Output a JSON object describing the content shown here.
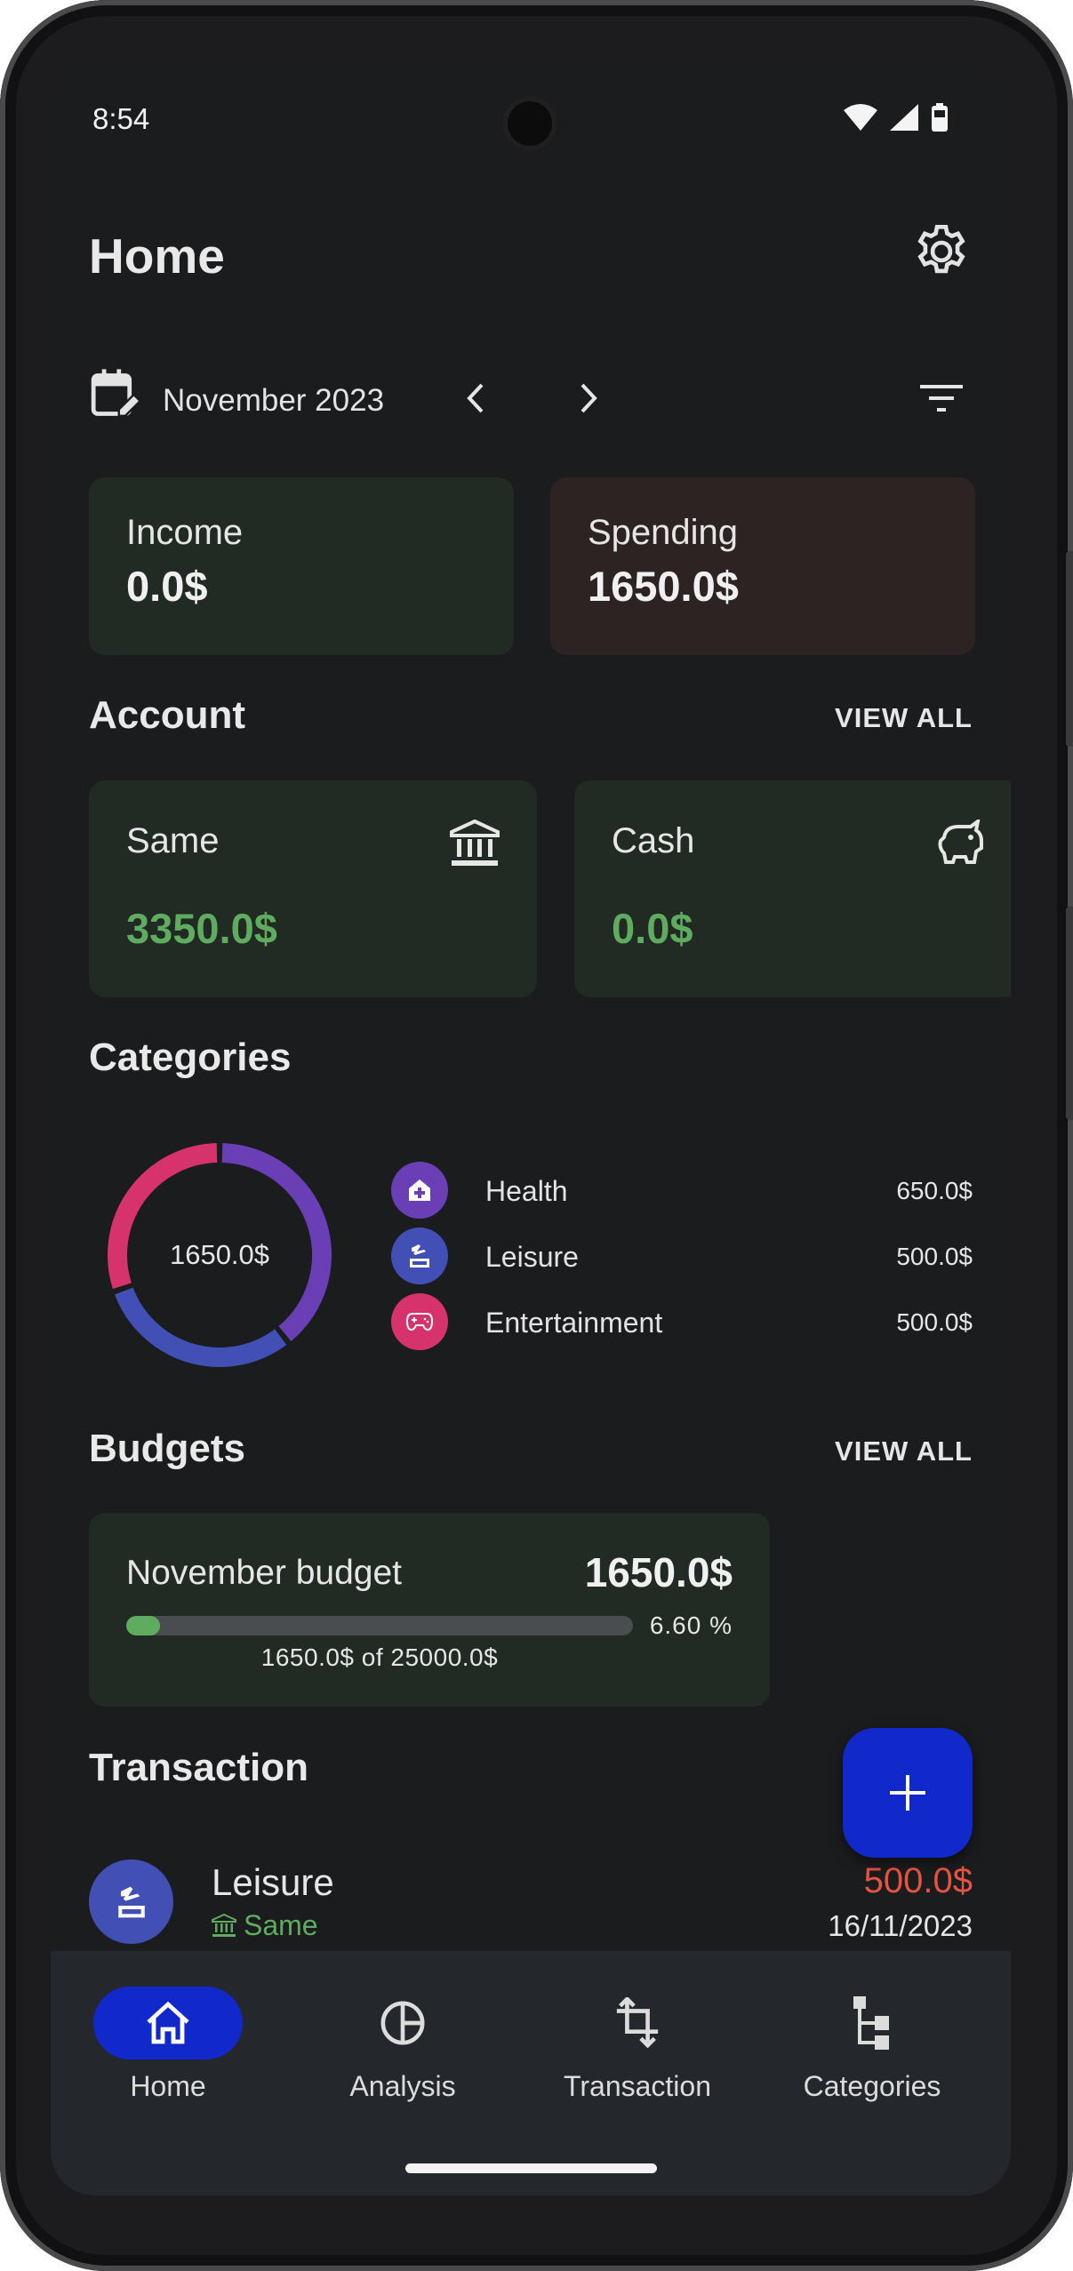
{
  "status_bar": {
    "time": "8:54"
  },
  "header": {
    "title": "Home",
    "settings_icon": "gear-icon"
  },
  "period": {
    "label": "November 2023",
    "prev_icon": "chevron-left-icon",
    "next_icon": "chevron-right-icon",
    "filter_icon": "filter-icon"
  },
  "summary": {
    "income": {
      "label": "Income",
      "value": "0.0$",
      "color": "#222a24"
    },
    "spending": {
      "label": "Spending",
      "value": "1650.0$",
      "color": "#2c2322"
    }
  },
  "accounts": {
    "title": "Account",
    "view_all": "VIEW ALL",
    "items": [
      {
        "name": "Same",
        "balance": "3350.0$",
        "icon": "bank-icon"
      },
      {
        "name": "Cash",
        "balance": "0.0$",
        "icon": "piggy-bank-icon"
      }
    ]
  },
  "categories": {
    "title": "Categories",
    "total": "1650.0$",
    "items": [
      {
        "name": "Health",
        "amount": "650.0$",
        "value": 650,
        "color": "#6a3fb6",
        "icon": "medical-icon"
      },
      {
        "name": "Leisure",
        "amount": "500.0$",
        "value": 500,
        "color": "#4250b5",
        "icon": "beach-icon"
      },
      {
        "name": "Entertainment",
        "amount": "500.0$",
        "value": 500,
        "color": "#d6336c",
        "icon": "gamepad-icon"
      }
    ]
  },
  "budgets": {
    "title": "Budgets",
    "view_all": "VIEW ALL",
    "items": [
      {
        "name": "November budget",
        "amount": "1650.0$",
        "progress": 0.066,
        "percent": "6.60 %",
        "detail": "1650.0$ of 25000.0$"
      }
    ]
  },
  "transactions": {
    "title": "Transaction",
    "items": [
      {
        "category": "Leisure",
        "account": "Same",
        "amount": "500.0$",
        "date": "16/11/2023"
      }
    ]
  },
  "fab": {
    "icon": "plus-icon"
  },
  "nav": {
    "items": [
      {
        "label": "Home",
        "icon": "home-icon",
        "active": true
      },
      {
        "label": "Analysis",
        "icon": "pie-chart-icon",
        "active": false
      },
      {
        "label": "Transaction",
        "icon": "transfer-icon",
        "active": false
      },
      {
        "label": "Categories",
        "icon": "category-tree-icon",
        "active": false
      }
    ]
  }
}
